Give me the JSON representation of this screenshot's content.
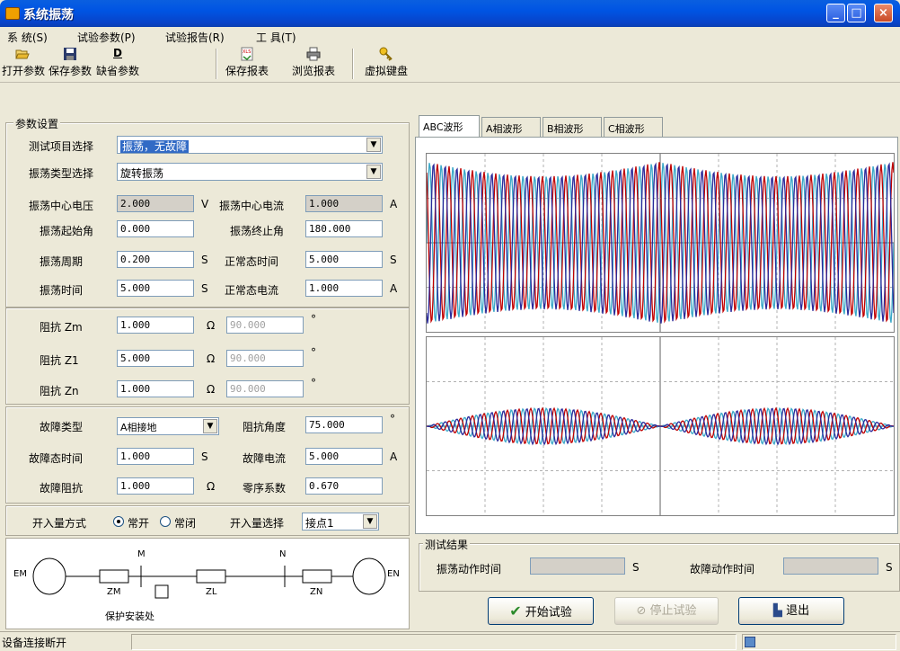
{
  "window": {
    "title": "系统振荡"
  },
  "menu": [
    "系 统(S)",
    "试验参数(P)",
    "试验报告(R)",
    "工 具(T)"
  ],
  "toolbar": [
    {
      "label": "打开参数",
      "icon": "open-folder-icon"
    },
    {
      "label": "保存参数",
      "icon": "floppy-disk-icon"
    },
    {
      "label": "缺省参数",
      "icon": "default-d-icon",
      "glyph": "D"
    },
    {
      "label": "保存报表",
      "icon": "excel-save-icon"
    },
    {
      "label": "浏览报表",
      "icon": "printer-icon"
    },
    {
      "label": "虚拟键盘",
      "icon": "key-icon"
    }
  ],
  "params": {
    "group_title": "参数设置",
    "test_item_label": "测试项目选择",
    "test_item_value": "振荡，无故障",
    "osc_type_label": "振荡类型选择",
    "osc_type_value": "旋转振荡",
    "center_voltage_label": "振荡中心电压",
    "center_voltage": "2.000",
    "center_voltage_unit": "V",
    "center_current_label": "振荡中心电流",
    "center_current": "1.000",
    "center_current_unit": "A",
    "start_angle_label": "振荡起始角",
    "start_angle": "0.000",
    "end_angle_label": "振荡终止角",
    "end_angle": "180.000",
    "period_label": "振荡周期",
    "period": "0.200",
    "period_unit": "S",
    "normal_time_label": "正常态时间",
    "normal_time": "5.000",
    "normal_time_unit": "S",
    "osc_time_label": "振荡时间",
    "osc_time": "5.000",
    "osc_time_unit": "S",
    "normal_current_label": "正常态电流",
    "normal_current": "1.000",
    "normal_current_unit": "A"
  },
  "impedance": [
    {
      "label": "阻抗 Zm",
      "value": "1.000",
      "unit": "Ω",
      "angle": "90.000",
      "deg": "°"
    },
    {
      "label": "阻抗 Z1",
      "value": "5.000",
      "unit": "Ω",
      "angle": "90.000",
      "deg": "°"
    },
    {
      "label": "阻抗 Zn",
      "value": "1.000",
      "unit": "Ω",
      "angle": "90.000",
      "deg": "°"
    }
  ],
  "fault": {
    "type_label": "故障类型",
    "type_value": "A相接地",
    "imp_angle_label": "阻抗角度",
    "imp_angle": "75.000",
    "imp_angle_unit": "°",
    "time_label": "故障态时间",
    "time": "1.000",
    "time_unit": "S",
    "current_label": "故障电流",
    "current": "5.000",
    "current_unit": "A",
    "resistance_label": "故障阻抗",
    "resistance": "1.000",
    "resistance_unit": "Ω",
    "zero_seq_label": "零序系数",
    "zero_seq": "0.670"
  },
  "switch": {
    "mode_label": "开入量方式",
    "opt_no": "常开",
    "opt_nc": "常闭",
    "select_label": "开入量选择",
    "select_value": "接点1"
  },
  "diagram": {
    "em": "EM",
    "en": "EN",
    "m": "M",
    "n": "N",
    "zm": "ZM",
    "zl": "ZL",
    "zn": "ZN",
    "caption": "保护安装处"
  },
  "tabs": [
    "ABC波形",
    "A相波形",
    "B相波形",
    "C相波形"
  ],
  "waveform_colors": {
    "a": "#3aa8c8",
    "b": "#c00000",
    "c": "#2a2a9a"
  },
  "result": {
    "group_title": "测试结果",
    "osc_action_label": "振荡动作时间",
    "osc_action_value": "",
    "osc_action_unit": "S",
    "fault_action_label": "故障动作时间",
    "fault_action_value": "",
    "fault_action_unit": "S"
  },
  "buttons": {
    "start": "开始试验",
    "stop": "停止试验",
    "exit": "退出"
  },
  "status": {
    "text": "设备连接断开"
  }
}
